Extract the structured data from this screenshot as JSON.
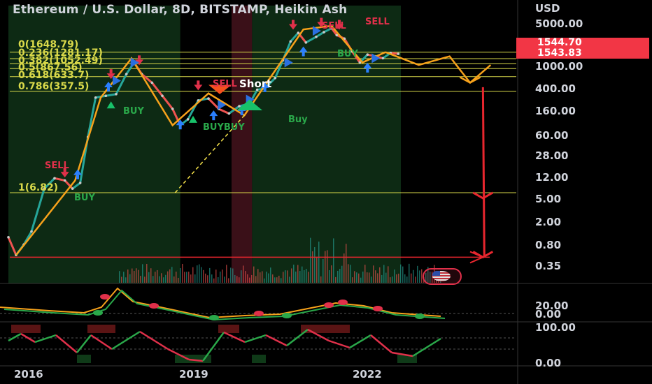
{
  "header": {
    "title": "Ethereum / U.S. Dollar, 8D, BITSTAMP, Heikin Ash",
    "currency": "USD"
  },
  "price_badges": [
    "1544.70",
    "1543.83"
  ],
  "price_axis_ticks": [
    "5000.00",
    "1000.00",
    "400.00",
    "160.00",
    "60.00",
    "28.00",
    "12.00",
    "5.00",
    "2.00",
    "0.80",
    "0.35"
  ],
  "oscillator1_ticks": [
    "20.00",
    "0.00"
  ],
  "oscillator2_ticks": [
    "100.00",
    "0.00"
  ],
  "time_axis_ticks": [
    "2016",
    "2019",
    "2022"
  ],
  "fib_labels": [
    "0(1648.79)",
    "0.236(1281.17)",
    "0.382(1052.49)",
    "0.5(867.56)",
    "0.618(633.7)",
    "0.786(357.5)",
    "1(6.82)"
  ],
  "signals": {
    "buy_labels": [
      "BUY",
      "BUY",
      "BUYBUY",
      "Buy",
      "BUY"
    ],
    "sell_labels": [
      "SELL",
      "SELL",
      "SELL",
      "SELL"
    ],
    "short_label": "Short"
  },
  "colors": {
    "background": "#000000",
    "bull_zone": "#0d2a14",
    "bear_zone": "#3a1018",
    "fib_lines": "#d9d94a",
    "zigzag": "#f7a21b",
    "projection": "#f7a21b",
    "target_arrow": "#e8262e",
    "candle_up": "#26a69a",
    "candle_down": "#ef5350",
    "badge": "#f23645"
  },
  "chart_data": {
    "type": "line",
    "scale": "log",
    "title": "Ethereum / U.S. Dollar, 8D, BITSTAMP, Heikin Ash",
    "xlabel": "",
    "ylabel": "USD",
    "x_range": [
      2015.6,
      2025.5
    ],
    "ylim": [
      0.35,
      5000
    ],
    "grid": false,
    "series": [
      {
        "x": [
          2015.6,
          2015.75,
          2015.9,
          2016.05,
          2016.3,
          2016.5,
          2016.7,
          2016.85,
          2017.0,
          2017.15,
          2017.3,
          2017.5,
          2017.7,
          2017.9,
          2018.05,
          2018.2,
          2018.4,
          2018.6,
          2018.8,
          2018.95,
          2019.1,
          2019.3,
          2019.5,
          2019.7,
          2019.9,
          2020.1,
          2020.3,
          2020.45,
          2020.6,
          2020.8,
          2020.95,
          2021.1,
          2021.25,
          2021.4,
          2021.6,
          2021.75,
          2021.9,
          2022.0,
          2022.15,
          2022.3,
          2022.45,
          2022.6,
          2022.75,
          2022.9,
          2023.05,
          2023.2
        ],
        "values": [
          1.2,
          0.6,
          0.9,
          1.5,
          8,
          12,
          11,
          8,
          10,
          60,
          280,
          300,
          320,
          700,
          1100,
          700,
          500,
          300,
          180,
          95,
          120,
          250,
          270,
          180,
          150,
          200,
          220,
          380,
          400,
          600,
          1200,
          2500,
          3500,
          2400,
          3000,
          3600,
          4200,
          3200,
          2800,
          1700,
          1100,
          1500,
          1400,
          1300,
          1600,
          1544.7
        ]
      }
    ],
    "fib_levels": [
      {
        "ratio": 0,
        "price": 1648.79
      },
      {
        "ratio": 0.236,
        "price": 1281.17
      },
      {
        "ratio": 0.382,
        "price": 1052.49
      },
      {
        "ratio": 0.5,
        "price": 867.56
      },
      {
        "ratio": 0.618,
        "price": 633.7
      },
      {
        "ratio": 0.786,
        "price": 357.5
      },
      {
        "ratio": 1,
        "price": 6.82
      }
    ],
    "zigzag": {
      "x": [
        2015.75,
        2016.9,
        2017.4,
        2018.0,
        2018.8,
        2019.5,
        2020.2,
        2021.35,
        2021.9,
        2022.5,
        2022.95
      ],
      "values": [
        0.6,
        11,
        280,
        1300,
        95,
        330,
        140,
        4000,
        4600,
        1100,
        1650
      ]
    },
    "projection": {
      "x": [
        2022.95,
        2023.6,
        2024.2,
        2024.6,
        2025.0
      ],
      "values": [
        1650,
        1000,
        1400,
        500,
        1000
      ]
    },
    "target_path": {
      "x": [
        2024.85,
        2024.85,
        2024.85,
        2024.85
      ],
      "values": [
        420,
        5.5,
        0.55,
        0.55
      ]
    },
    "horizontal_lines": [
      {
        "price": 0.55,
        "color": "#e8262e"
      }
    ]
  }
}
